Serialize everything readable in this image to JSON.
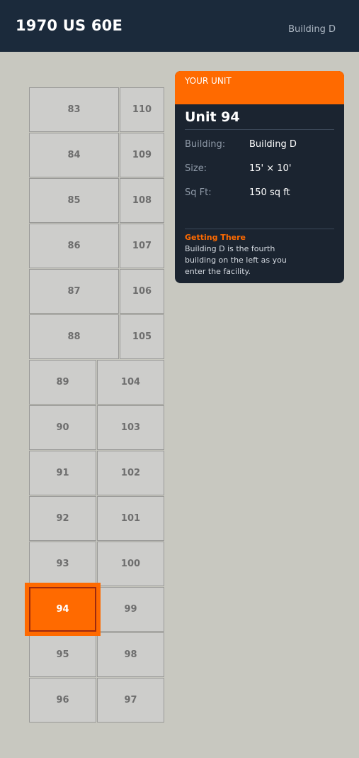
{
  "header": {
    "title": "1970 US 60E",
    "building": "Building D"
  },
  "units": {
    "left_upper": [
      "83",
      "84",
      "85",
      "86",
      "87",
      "88"
    ],
    "right_upper": [
      "110",
      "109",
      "108",
      "107",
      "106",
      "105"
    ],
    "left_lower": [
      "89",
      "90",
      "91",
      "92",
      "93",
      "94",
      "95",
      "96"
    ],
    "right_lower": [
      "104",
      "103",
      "102",
      "101",
      "100",
      "99",
      "98",
      "97"
    ],
    "selected": "94"
  },
  "card": {
    "band_label": "YOUR UNIT",
    "unit_title": "Unit 94",
    "building_label": "Building:",
    "building_value": "Building D",
    "size_label": "Size:",
    "size_value": "15' × 10'",
    "sqft_label": "Sq Ft:",
    "sqft_value": "150 sq ft",
    "directions_label": "Getting There",
    "directions_text": "Building D is the fourth building on the left as you enter the facility."
  },
  "colors": {
    "header_bg": "#1b2a3b",
    "accent": "#ff6a00",
    "card_bg": "#1b2430",
    "page_bg": "#c8c8c0"
  }
}
